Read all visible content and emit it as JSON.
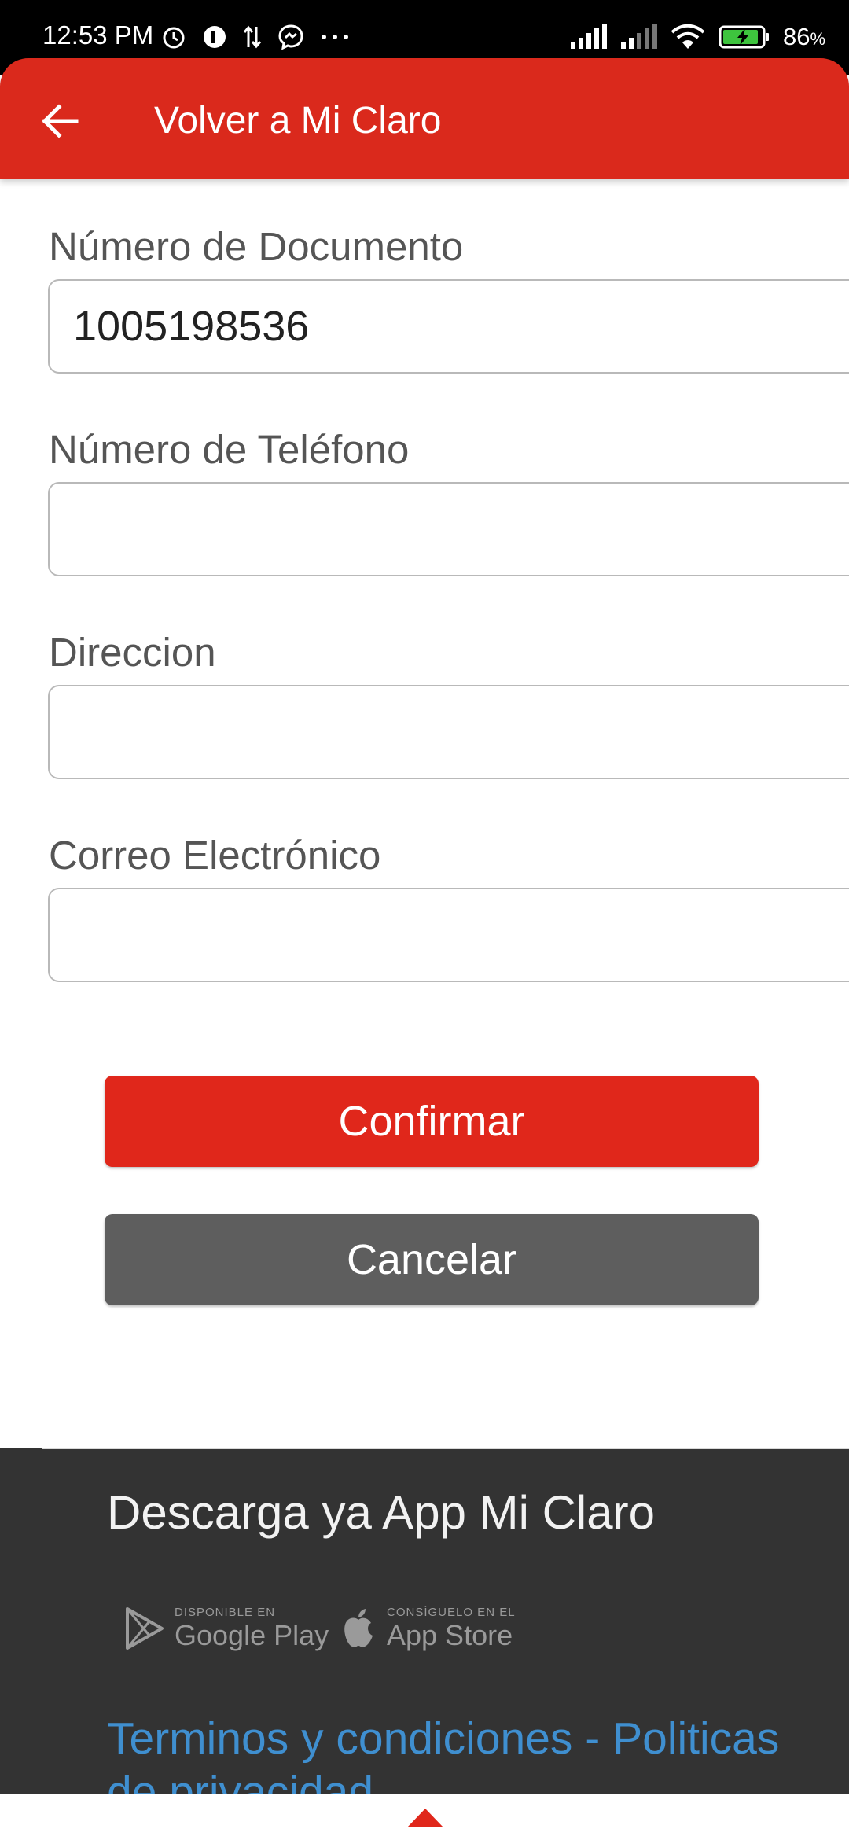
{
  "status_bar": {
    "time": "12:53 PM",
    "battery": "86",
    "battery_unit": "%",
    "icons_left": [
      "alarm-icon",
      "app-icon",
      "data-transfer-icon",
      "messenger-icon",
      "more-icon"
    ],
    "icons_right": [
      "signal-icon",
      "signal-icon",
      "wifi-icon",
      "battery-charging-icon"
    ]
  },
  "header": {
    "title": "Volver a Mi Claro",
    "back_icon": "arrow-left-icon"
  },
  "form": {
    "document": {
      "label": "Número de Documento",
      "value": "1005198536"
    },
    "phone": {
      "label": "Número de Teléfono",
      "value": ""
    },
    "address": {
      "label": "Direccion",
      "value": ""
    },
    "email": {
      "label": "Correo Electrónico",
      "value": ""
    }
  },
  "buttons": {
    "confirm": "Confirmar",
    "cancel": "Cancelar"
  },
  "footer": {
    "title": "Descarga ya App Mi Claro",
    "google_play": {
      "small": "DISPONIBLE EN",
      "big": "Google Play"
    },
    "app_store": {
      "small": "CONSÍGUELO EN EL",
      "big": "App Store"
    },
    "terms": "Terminos y condiciones - Politicas de privacidad"
  },
  "colors": {
    "brand_red": "#da291c",
    "confirm_red": "#e0271b",
    "cancel_gray": "#5e5e5e",
    "footer_bg": "#333333",
    "link_blue": "#3f8fd0"
  }
}
